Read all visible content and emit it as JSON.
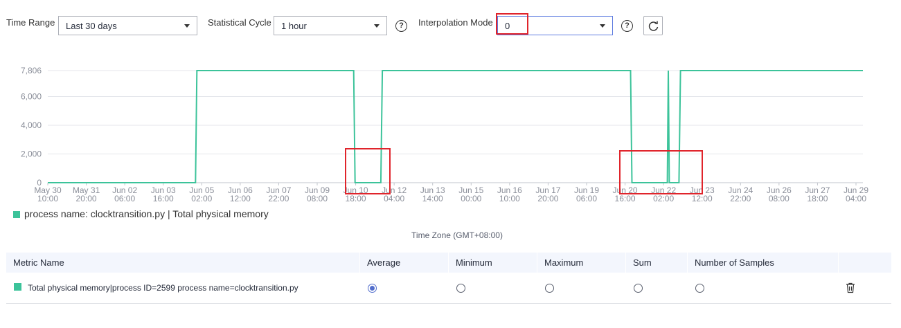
{
  "toolbar": {
    "time_range_label": "Time Range",
    "time_range_value": "Last 30 days",
    "stat_cycle_label": "Statistical Cycle",
    "stat_cycle_value": "1 hour",
    "interp_label": "Interpolation Mode",
    "interp_value": "0",
    "help_glyph": "?",
    "refresh_icon": "refresh-icon"
  },
  "chart_data": {
    "type": "line",
    "series": [
      {
        "name": "process name: clocktransition.py | Total physical memory",
        "color": "#3cc39a",
        "points": [
          [
            0,
            0
          ],
          [
            7.63,
            0
          ],
          [
            7.7,
            7806
          ],
          [
            15.8,
            7806
          ],
          [
            15.87,
            0
          ],
          [
            17.2,
            0
          ],
          [
            17.28,
            7806
          ],
          [
            30.1,
            7806
          ],
          [
            30.17,
            0
          ],
          [
            32.0,
            0
          ],
          [
            32.05,
            7806
          ],
          [
            32.1,
            0
          ],
          [
            32.6,
            0
          ],
          [
            32.68,
            7806
          ],
          [
            42.1,
            7806
          ]
        ]
      }
    ],
    "yticks": [
      "0",
      "2,000",
      "4,000",
      "6,000",
      "7,806"
    ],
    "ytick_values": [
      0,
      2000,
      4000,
      6000,
      7806
    ],
    "ylim": [
      0,
      7806
    ],
    "xticks": [
      [
        "May 30",
        "10:00"
      ],
      [
        "May 31",
        "20:00"
      ],
      [
        "Jun 02",
        "06:00"
      ],
      [
        "Jun 03",
        "16:00"
      ],
      [
        "Jun 05",
        "02:00"
      ],
      [
        "Jun 06",
        "12:00"
      ],
      [
        "Jun 07",
        "22:00"
      ],
      [
        "Jun 09",
        "08:00"
      ],
      [
        "Jun 10",
        "18:00"
      ],
      [
        "Jun 12",
        "04:00"
      ],
      [
        "Jun 13",
        "14:00"
      ],
      [
        "Jun 15",
        "00:00"
      ],
      [
        "Jun 16",
        "10:00"
      ],
      [
        "Jun 17",
        "20:00"
      ],
      [
        "Jun 19",
        "06:00"
      ],
      [
        "Jun 20",
        "16:00"
      ],
      [
        "Jun 22",
        "02:00"
      ],
      [
        "Jun 23",
        "12:00"
      ],
      [
        "Jun 24",
        "22:00"
      ],
      [
        "Jun 26",
        "08:00"
      ],
      [
        "Jun 27",
        "18:00"
      ],
      [
        "Jun 29",
        "04:00"
      ]
    ],
    "grid": true,
    "legend_position": "bottom-left"
  },
  "legend": {
    "text": "process name: clocktransition.py | Total physical memory"
  },
  "timezone": "Time Zone (GMT+08:00)",
  "table": {
    "headers": [
      "Metric Name",
      "Average",
      "Minimum",
      "Maximum",
      "Sum",
      "Number of Samples"
    ],
    "rows": [
      {
        "metric": "Total physical memory|process ID=2599 process name=clocktransition.py",
        "selected": "Average"
      }
    ],
    "delete_icon": "trash-icon"
  }
}
